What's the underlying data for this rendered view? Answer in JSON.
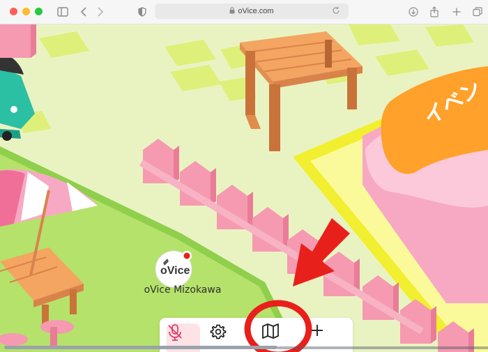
{
  "browser": {
    "url": "oVice.com",
    "icons": [
      "sidebar-icon",
      "back-icon",
      "forward-icon",
      "privacy-icon",
      "lock-icon",
      "reload-icon",
      "download-icon",
      "share-icon",
      "new-tab-icon",
      "tabs-icon"
    ]
  },
  "scene": {
    "sign_text": "イベン",
    "avatar": {
      "logo_text": "oVice",
      "name": "oVice Mizokawa"
    }
  },
  "toolbar": {
    "buttons": [
      {
        "name": "mic-muted-button",
        "icon": "mic-off-icon",
        "state": "muted"
      },
      {
        "name": "settings-button",
        "icon": "gear-icon"
      },
      {
        "name": "map-button",
        "icon": "map-icon"
      },
      {
        "name": "add-button",
        "icon": "plus-icon"
      }
    ]
  },
  "annotation": {
    "arrow_color": "#e8201c",
    "circle_color": "#e8201c",
    "target": "map-button"
  },
  "colors": {
    "floor": "#e9f3c2",
    "tile": "#dff07a",
    "fence": "#f59ab0",
    "pink_stage": "#f7a9c3",
    "yellow_border": "#f1ef2f",
    "orange_sign": "#ffa12a",
    "bench_wood": "#f0a05b",
    "mic_active_bg": "#fde3e6",
    "mic_icon": "#e23b6b"
  }
}
